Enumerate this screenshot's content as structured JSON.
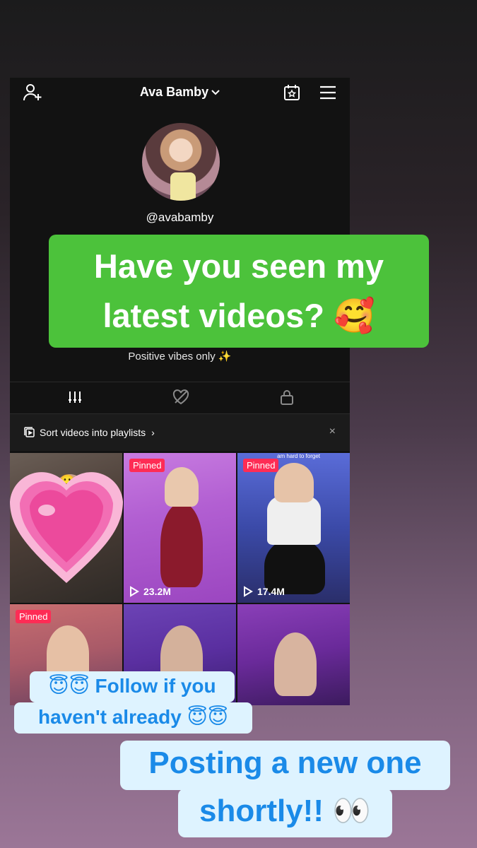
{
  "profile": {
    "display_name": "Ava Bamby",
    "handle": "@avabamby",
    "bio": "Positive vibes only ✨"
  },
  "tabs": [
    {
      "icon": "videos-grid-icon",
      "active": true
    },
    {
      "icon": "liked-heart-icon",
      "active": false
    },
    {
      "icon": "private-lock-icon",
      "active": false
    }
  ],
  "playlist_bar": {
    "label": "Sort videos into playlists",
    "chevron": "›",
    "close": "×"
  },
  "videos": [
    {
      "pinned": false,
      "views": ""
    },
    {
      "pinned": true,
      "pinned_label": "Pinned",
      "views": "23.2M"
    },
    {
      "pinned": true,
      "pinned_label": "Pinned",
      "views": "17.4M",
      "caption": "am hard to forget"
    },
    {
      "pinned": true,
      "pinned_label": "Pinned",
      "views": ""
    },
    {
      "pinned": false,
      "views": ""
    },
    {
      "pinned": false,
      "views": ""
    }
  ],
  "stickers": {
    "headline_line1": "Have you seen my",
    "headline_line2": "latest videos? 🥰",
    "follow_line1": "😇😇 Follow if you",
    "follow_line2": "haven't already 😇😇",
    "posting_line1": "Posting a new one",
    "posting_line2": "shortly!! 👀"
  },
  "colors": {
    "accent_pinned": "#fe2c55",
    "headline_bg": "#4cc23b",
    "sticker_bg": "#def3ff",
    "sticker_text": "#1a8ae8"
  }
}
